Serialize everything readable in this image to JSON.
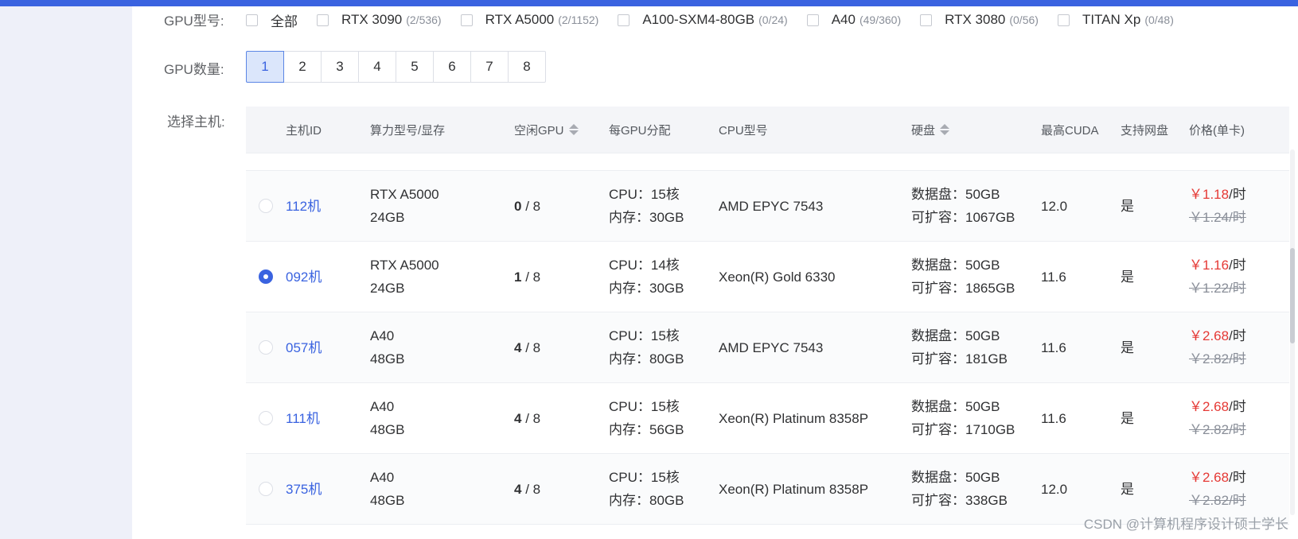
{
  "labels": {
    "gpu_model": "GPU型号:",
    "gpu_count": "GPU数量:",
    "select_host": "选择主机:"
  },
  "gpu_models": [
    {
      "name": "全部",
      "count": ""
    },
    {
      "name": "RTX 3090",
      "count": "(2/536)"
    },
    {
      "name": "RTX A5000",
      "count": "(2/1152)"
    },
    {
      "name": "A100-SXM4-80GB",
      "count": "(0/24)"
    },
    {
      "name": "A40",
      "count": "(49/360)"
    },
    {
      "name": "RTX 3080",
      "count": "(0/56)"
    },
    {
      "name": "TITAN Xp",
      "count": "(0/48)"
    }
  ],
  "gpu_counts": [
    "1",
    "2",
    "3",
    "4",
    "5",
    "6",
    "7",
    "8"
  ],
  "gpu_count_selected": "1",
  "table": {
    "headers": {
      "host_id": "主机ID",
      "model": "算力型号/显存",
      "free_gpu": "空闲GPU",
      "per_gpu": "每GPU分配",
      "cpu_model": "CPU型号",
      "disk": "硬盘",
      "cuda": "最高CUDA",
      "net_disk": "支持网盘",
      "price": "价格(单卡)"
    },
    "rows": [
      {
        "selected": false,
        "host": "112机",
        "gpu": "RTX A5000",
        "mem": "24GB",
        "free": "0",
        "total": " / 8",
        "cpu_alloc": "CPU：15核",
        "ram_alloc": "内存：30GB",
        "cpu": "AMD EPYC 7543",
        "data_disk": "数据盘：50GB",
        "expand": "可扩容：1067GB",
        "cuda": "12.0",
        "net": "是",
        "price": "￥1.18",
        "unit": "/时",
        "old_price": "￥1.24/时"
      },
      {
        "selected": true,
        "host": "092机",
        "gpu": "RTX A5000",
        "mem": "24GB",
        "free": "1",
        "total": " / 8",
        "cpu_alloc": "CPU：14核",
        "ram_alloc": "内存：30GB",
        "cpu": "Xeon(R) Gold 6330",
        "data_disk": "数据盘：50GB",
        "expand": "可扩容：1865GB",
        "cuda": "11.6",
        "net": "是",
        "price": "￥1.16",
        "unit": "/时",
        "old_price": "￥1.22/时"
      },
      {
        "selected": false,
        "host": "057机",
        "gpu": "A40",
        "mem": "48GB",
        "free": "4",
        "total": " / 8",
        "cpu_alloc": "CPU：15核",
        "ram_alloc": "内存：80GB",
        "cpu": "AMD EPYC 7543",
        "data_disk": "数据盘：50GB",
        "expand": "可扩容：181GB",
        "cuda": "11.6",
        "net": "是",
        "price": "￥2.68",
        "unit": "/时",
        "old_price": "￥2.82/时"
      },
      {
        "selected": false,
        "host": "111机",
        "gpu": "A40",
        "mem": "48GB",
        "free": "4",
        "total": " / 8",
        "cpu_alloc": "CPU：15核",
        "ram_alloc": "内存：56GB",
        "cpu": "Xeon(R) Platinum 8358P",
        "data_disk": "数据盘：50GB",
        "expand": "可扩容：1710GB",
        "cuda": "11.6",
        "net": "是",
        "price": "￥2.68",
        "unit": "/时",
        "old_price": "￥2.82/时"
      },
      {
        "selected": false,
        "host": "375机",
        "gpu": "A40",
        "mem": "48GB",
        "free": "4",
        "total": " / 8",
        "cpu_alloc": "CPU：15核",
        "ram_alloc": "内存：80GB",
        "cpu": "Xeon(R) Platinum 8358P",
        "data_disk": "数据盘：50GB",
        "expand": "可扩容：338GB",
        "cuda": "12.0",
        "net": "是",
        "price": "￥2.68",
        "unit": "/时",
        "old_price": "￥2.82/时"
      }
    ]
  },
  "watermark": "CSDN @计算机程序设计硕士学长",
  "colors": {
    "accent": "#3a63e0",
    "price": "#e53935",
    "sidebar": "#eef0f9"
  }
}
